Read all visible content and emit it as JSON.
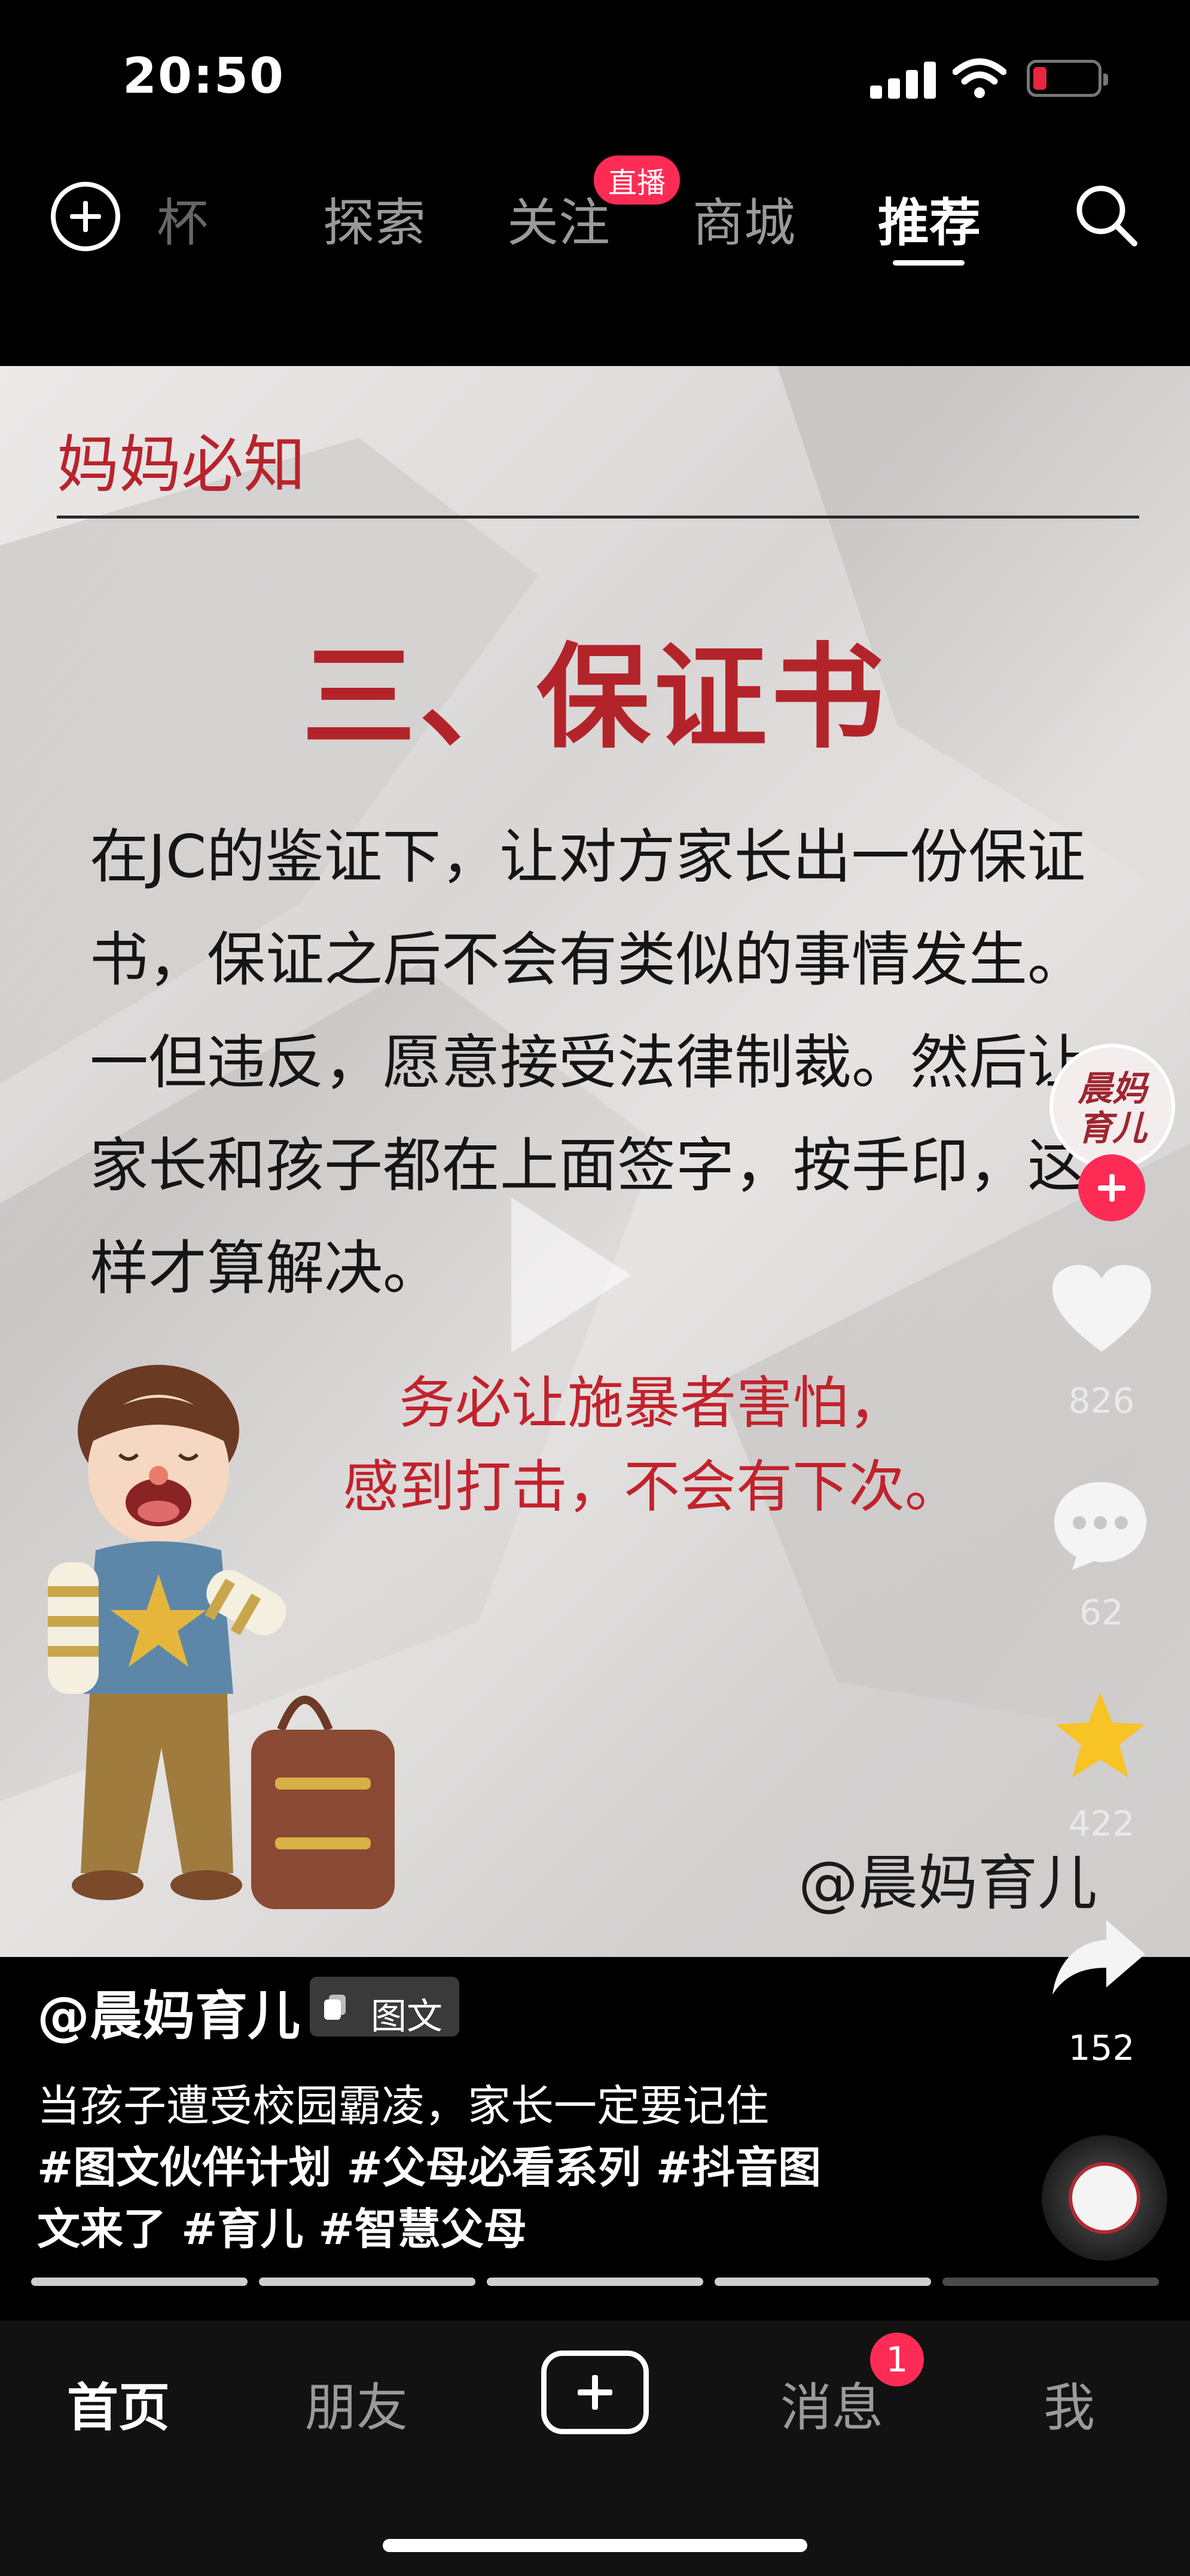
{
  "status_bar": {
    "time": "20:50"
  },
  "top_nav": {
    "tabs": [
      {
        "label": "杯",
        "active": false
      },
      {
        "label": "探索",
        "active": false
      },
      {
        "label": "关注",
        "active": false,
        "badge": "直播"
      },
      {
        "label": "商城",
        "active": false
      },
      {
        "label": "推荐",
        "active": true
      }
    ]
  },
  "post_image": {
    "tag": "妈妈必知",
    "title": "三、保证书",
    "body": "在JC的鉴证下，让对方家长出一份保证书，保证之后不会有类似的事情发生。一但违反，愿意接受法律制裁。然后让家长和孩子都在上面签字，按手印，这样才算解决。",
    "emphasis_line1": "务必让施暴者害怕，",
    "emphasis_line2": "感到打击，不会有下次。",
    "watermark": "@晨妈育儿"
  },
  "author": {
    "avatar_text_line1": "晨妈",
    "avatar_text_line2": "育儿"
  },
  "actions": {
    "likes": "826",
    "comments": "62",
    "favorites": "422",
    "shares": "152"
  },
  "caption": {
    "username": "@晨妈育儿",
    "badge_label": "图文",
    "text": "当孩子遭受校园霸凌，家长一定要记住",
    "tags_line1": "#图文伙伴计划 #父母必看系列 #抖音图",
    "tags_line2": "文来了 #育儿 #智慧父母"
  },
  "image_progress": {
    "total": 5,
    "current": 4
  },
  "tab_bar": {
    "home": "首页",
    "friends": "朋友",
    "messages": "消息",
    "messages_badge": "1",
    "me": "我"
  },
  "colors": {
    "accent": "#fe2c55",
    "title_red": "#b3242a",
    "card_bg": "#e4e1e1"
  }
}
